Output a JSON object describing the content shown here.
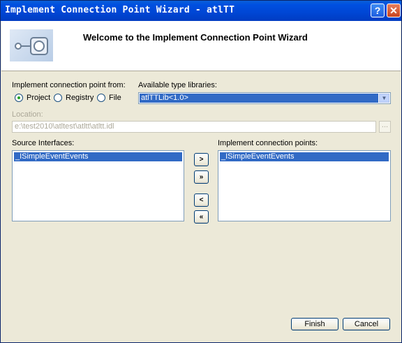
{
  "window": {
    "title": "Implement Connection Point Wizard - atlTT",
    "help_label": "?",
    "close_label": "✕"
  },
  "header": {
    "heading": "Welcome to the Implement Connection Point Wizard",
    "logo_icon": "connection-point-icon"
  },
  "implement_from": {
    "label": "Implement connection point from:",
    "options": [
      {
        "label": "Project",
        "selected": true
      },
      {
        "label": "Registry",
        "selected": false
      },
      {
        "label": "File",
        "selected": false
      }
    ]
  },
  "type_libraries": {
    "label": "Available type libraries:",
    "value": "atlTTLib<1.0>"
  },
  "location": {
    "label": "Location:",
    "value": "e:\\test2010\\atltest\\atltt\\atltt.idl",
    "browse_label": "..."
  },
  "source_interfaces": {
    "label": "Source Interfaces:",
    "items": [
      "_ISimpleEventEvents"
    ]
  },
  "connection_points": {
    "label": "Implement connection points:",
    "items": [
      "_ISimpleEventEvents"
    ]
  },
  "move_buttons": {
    "add": ">",
    "add_all": "»",
    "remove": "<",
    "remove_all": "«"
  },
  "footer": {
    "finish": "Finish",
    "cancel": "Cancel"
  },
  "colors": {
    "title_bar": "#0050e0",
    "selection": "#316ac5",
    "dialog_bg": "#ece9d8"
  }
}
